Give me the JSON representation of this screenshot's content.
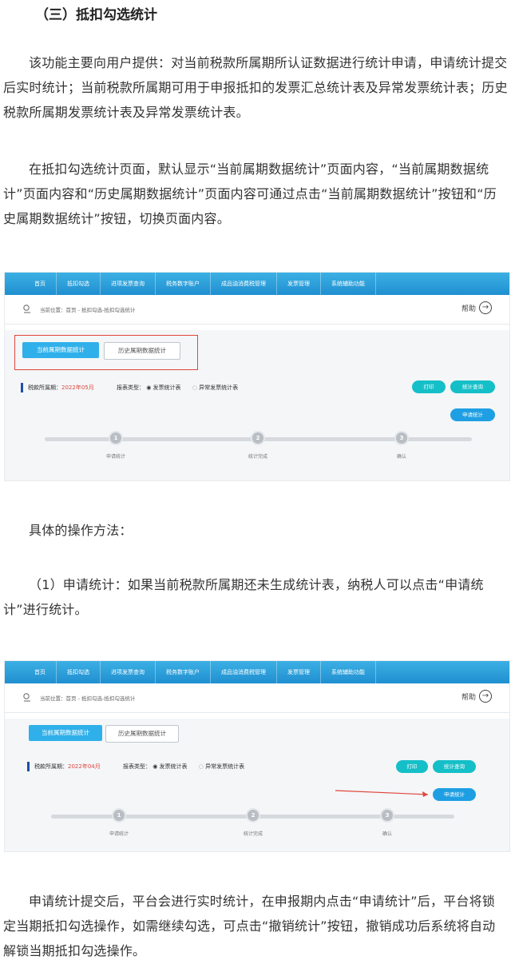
{
  "heading": "（三）抵扣勾选统计",
  "paragraphs": [
    "该功能主要向用户提供：对当前税款所属期所认证数据进行统计申请，申请统计提交后实时统计；当前税款所属期可用于申报抵扣的发票汇总统计表及异常发票统计表；历史税款所属期发票统计表及异常发票统计表。",
    "在抵扣勾选统计页面，默认显示“当前属期数据统计”页面内容，“当前属期数据统计”页面内容和“历史属期数据统计”页面内容可通过点击“当前属期数据统计”按钮和“历史属期数据统计”按钮，切换页面内容。",
    "具体的操作方法：",
    "（1）申请统计：如果当前税款所属期还未生成统计表，纳税人可以点击“申请统计”进行统计。",
    "申请统计提交后，平台会进行实时统计，在申报期内点击“申请统计”后，平台将锁定当期抵扣勾选操作，如需继续勾选，可点击“撤销统计”按钮，撤销成功后系统将自动解锁当期抵扣勾选操作。"
  ],
  "screens": [
    {
      "nav": [
        "首页",
        "抵扣勾选",
        "进项发票查询",
        "税务数字账户",
        "成品油消费税管理",
        "发票管理",
        "系统辅助功能"
      ],
      "crumb": "当前位置：首页 - 抵扣勾选-抵扣勾选统计",
      "help": "帮助",
      "tab_current": "当前属期数据统计",
      "tab_history": "历史属期数据统计",
      "period_label": "税款所属期：",
      "period_value": "2022年05月",
      "report_label": "报表类型：",
      "radio_invoice": "发票统计表",
      "radio_abnormal": "异常发票统计表",
      "btn_print": "打印",
      "btn_query": "统计查询",
      "btn_apply": "申请统计",
      "steps": [
        {
          "num": "1",
          "label": "申请统计"
        },
        {
          "num": "2",
          "label": "统计完成"
        },
        {
          "num": "3",
          "label": "确认"
        }
      ]
    },
    {
      "nav": [
        "首页",
        "抵扣勾选",
        "进项发票查询",
        "税务数字账户",
        "成品油消费税管理",
        "发票管理",
        "系统辅助功能"
      ],
      "crumb": "当前位置：首页 - 抵扣勾选-抵扣勾选统计",
      "help": "帮助",
      "tab_current": "当前属期数据统计",
      "tab_history": "历史属期数据统计",
      "period_label": "税款所属期：",
      "period_value": "2022年04月",
      "report_label": "报表类型：",
      "radio_invoice": "发票统计表",
      "radio_abnormal": "异常发票统计表",
      "btn_print": "打印",
      "btn_query": "统计查询",
      "btn_apply": "申请统计",
      "steps": [
        {
          "num": "1",
          "label": "申请统计"
        },
        {
          "num": "2",
          "label": "统计完成"
        },
        {
          "num": "3",
          "label": "确认"
        }
      ]
    }
  ],
  "colors": {
    "accent": "#2fb0ea",
    "highlight": "#e0463c",
    "teal": "#15bfc8"
  }
}
